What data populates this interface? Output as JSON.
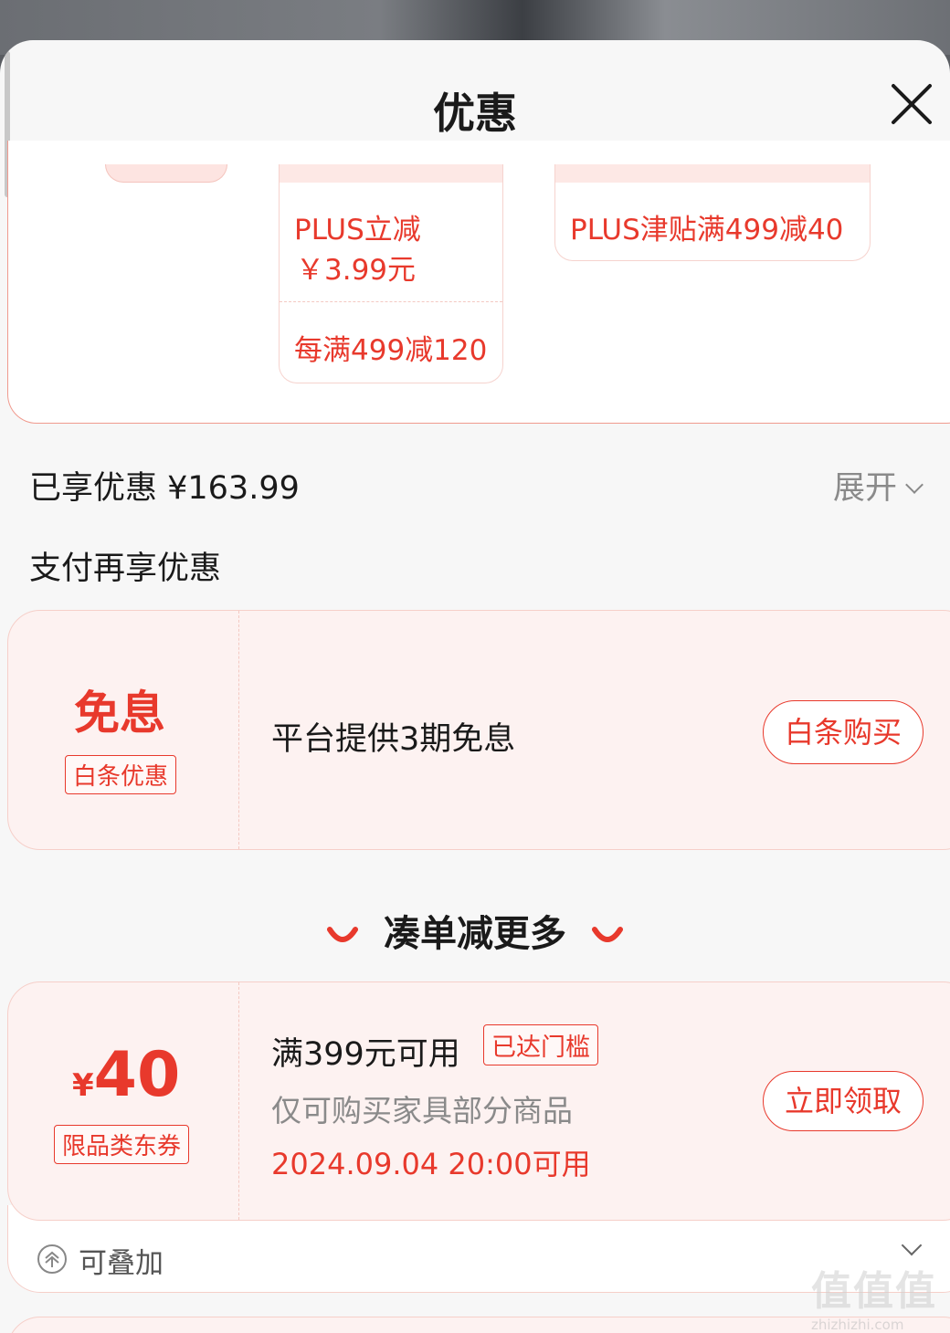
{
  "sheet": {
    "title": "优惠"
  },
  "top_offers": {
    "plus_card": {
      "line1": "PLUS立减",
      "line2": "￥3.99元",
      "line3": "每满499减120"
    },
    "subsidy_card": {
      "label": "PLUS津贴满499减40"
    }
  },
  "summary": {
    "enjoyed_label": "已享优惠 ¥163.99",
    "expand_label": "展开"
  },
  "payment": {
    "section_label": "支付再享优惠",
    "card": {
      "big": "免息",
      "tag": "白条优惠",
      "desc": "平台提供3期免息",
      "button": "白条购买"
    }
  },
  "more": {
    "title": "凑单减更多",
    "coupon": {
      "currency": "¥",
      "amount": "40",
      "tag": "限品类东券",
      "condition": "满399元可用",
      "badge": "已达门槛",
      "scope": "仅可购买家具部分商品",
      "time": "2024.09.04 20:00可用",
      "button": "立即领取",
      "stack_label": "可叠加"
    }
  },
  "watermark": {
    "logo": "值值值",
    "url": "zhizhizhi.com"
  },
  "colors": {
    "accent": "#e8392c",
    "card_bg": "#fdf2f1",
    "sheet_bg": "#f7f7f7"
  }
}
